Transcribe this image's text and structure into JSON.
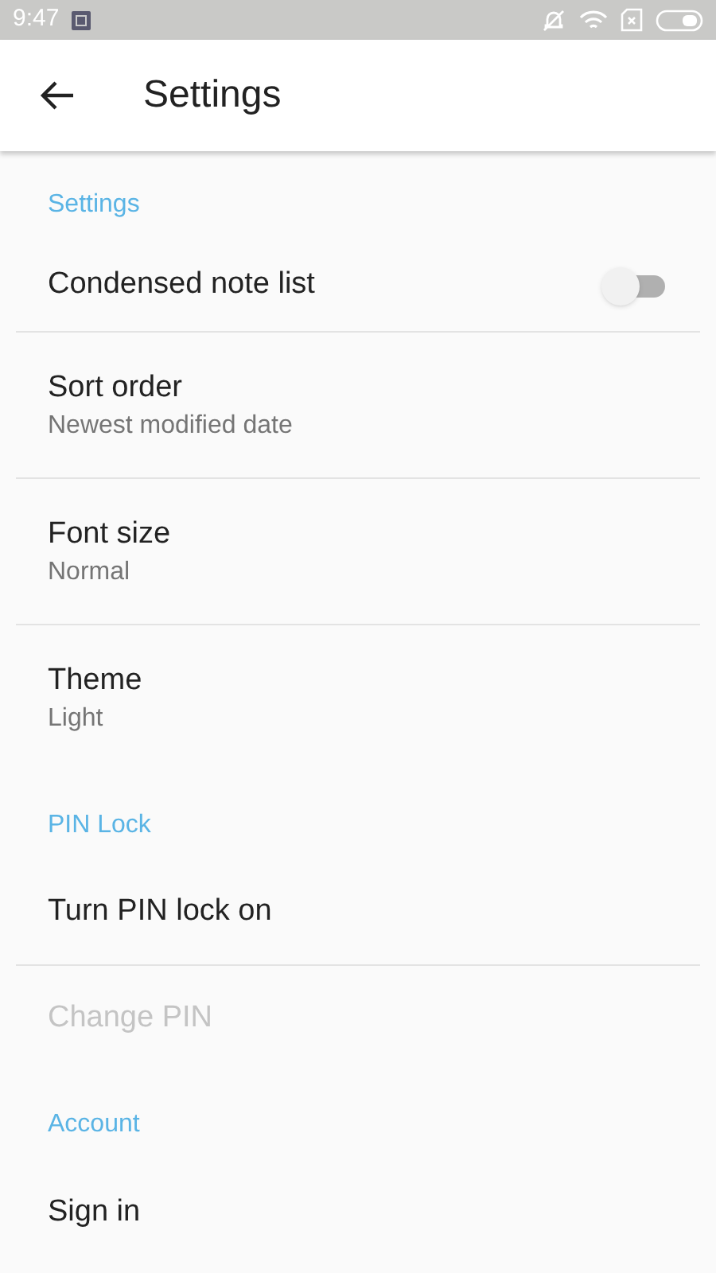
{
  "status_bar": {
    "time": "9:47"
  },
  "app_bar": {
    "title": "Settings"
  },
  "sections": [
    {
      "title": "Settings",
      "items": [
        {
          "kind": "toggle",
          "label": "Condensed note list",
          "on": false
        },
        {
          "kind": "value",
          "label": "Sort order",
          "value": "Newest modified date"
        },
        {
          "kind": "value",
          "label": "Font size",
          "value": "Normal"
        },
        {
          "kind": "value",
          "label": "Theme",
          "value": "Light"
        }
      ]
    },
    {
      "title": "PIN Lock",
      "items": [
        {
          "kind": "action",
          "label": "Turn PIN lock on",
          "disabled": false
        },
        {
          "kind": "action",
          "label": "Change PIN",
          "disabled": true
        }
      ]
    },
    {
      "title": "Account",
      "items": [
        {
          "kind": "action",
          "label": "Sign in",
          "disabled": false
        }
      ]
    }
  ]
}
